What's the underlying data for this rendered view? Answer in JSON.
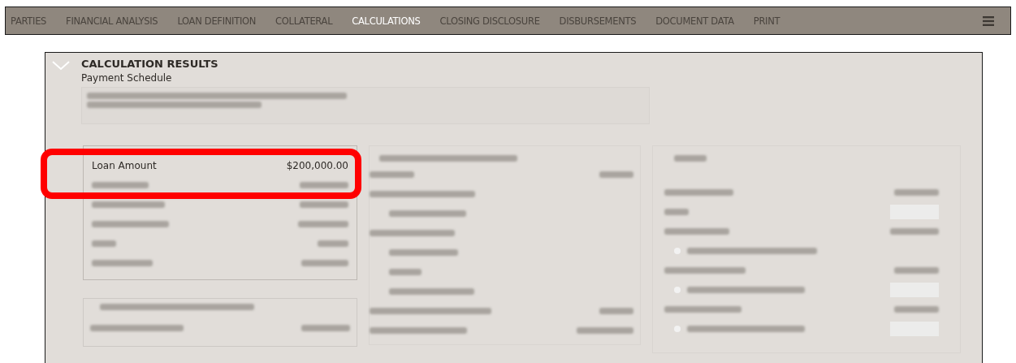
{
  "nav": {
    "tabs": [
      {
        "label": "PARTIES",
        "selected": false
      },
      {
        "label": "FINANCIAL ANALYSIS",
        "selected": false
      },
      {
        "label": "LOAN DEFINITION",
        "selected": false
      },
      {
        "label": "COLLATERAL",
        "selected": false
      },
      {
        "label": "CALCULATIONS",
        "selected": true
      },
      {
        "label": "CLOSING DISCLOSURE",
        "selected": false
      },
      {
        "label": "DISBURSEMENTS",
        "selected": false
      },
      {
        "label": "DOCUMENT DATA",
        "selected": false
      },
      {
        "label": "PRINT",
        "selected": false
      }
    ]
  },
  "section": {
    "title": "CALCULATION RESULTS",
    "expanded": true,
    "subtitle": "Payment Schedule",
    "summary": {
      "label": "Loan Amount",
      "value": "$200,000.00",
      "highlighted": true
    },
    "ratio_options": [
      {
        "checked": false
      },
      {
        "checked": false
      },
      {
        "checked": false
      }
    ]
  }
}
